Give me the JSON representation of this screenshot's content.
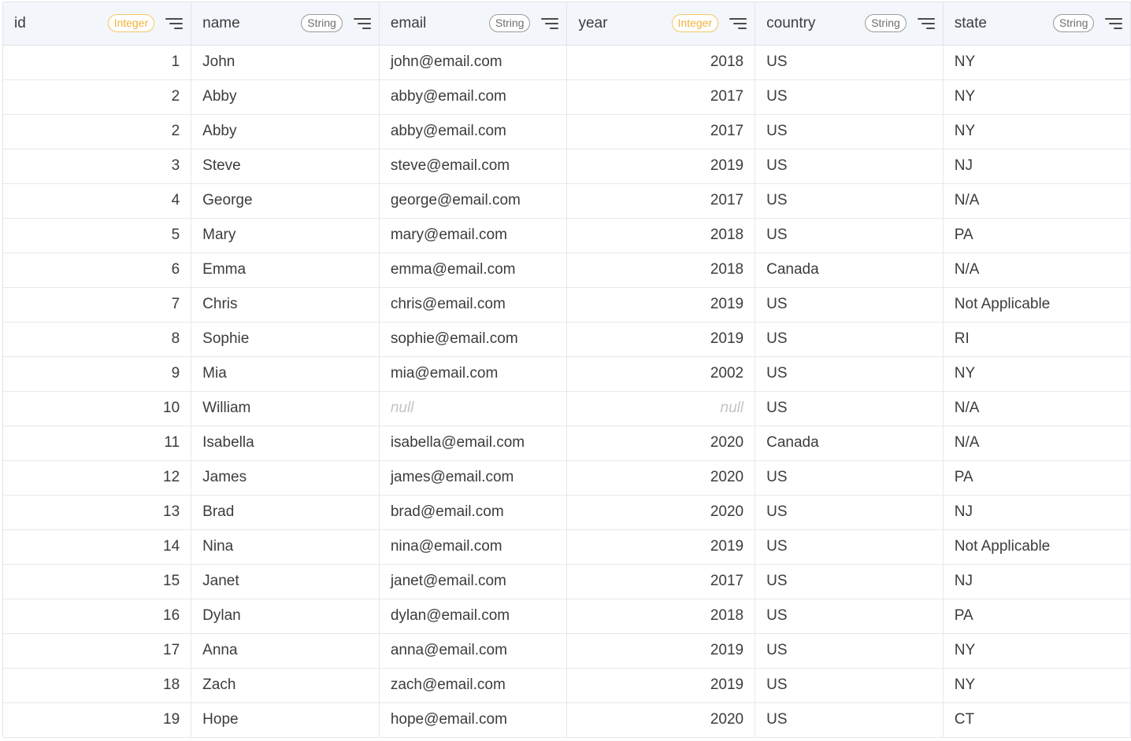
{
  "columns": [
    {
      "key": "id",
      "label": "id",
      "type": "Integer"
    },
    {
      "key": "name",
      "label": "name",
      "type": "String"
    },
    {
      "key": "email",
      "label": "email",
      "type": "String"
    },
    {
      "key": "year",
      "label": "year",
      "type": "Integer"
    },
    {
      "key": "country",
      "label": "country",
      "type": "String"
    },
    {
      "key": "state",
      "label": "state",
      "type": "String"
    }
  ],
  "null_text": "null",
  "rows": [
    {
      "id": "1",
      "name": "John",
      "email": "john@email.com",
      "year": "2018",
      "country": "US",
      "state": "NY"
    },
    {
      "id": "2",
      "name": "Abby",
      "email": "abby@email.com",
      "year": "2017",
      "country": "US",
      "state": "NY"
    },
    {
      "id": "2",
      "name": "Abby",
      "email": "abby@email.com",
      "year": "2017",
      "country": "US",
      "state": "NY"
    },
    {
      "id": "3",
      "name": "Steve",
      "email": "steve@email.com",
      "year": "2019",
      "country": "US",
      "state": "NJ"
    },
    {
      "id": "4",
      "name": "George",
      "email": "george@email.com",
      "year": "2017",
      "country": "US",
      "state": "N/A"
    },
    {
      "id": "5",
      "name": "Mary",
      "email": "mary@email.com",
      "year": "2018",
      "country": "US",
      "state": "PA"
    },
    {
      "id": "6",
      "name": "Emma",
      "email": "emma@email.com",
      "year": "2018",
      "country": "Canada",
      "state": "N/A"
    },
    {
      "id": "7",
      "name": "Chris",
      "email": "chris@email.com",
      "year": "2019",
      "country": "US",
      "state": "Not Applicable"
    },
    {
      "id": "8",
      "name": "Sophie",
      "email": "sophie@email.com",
      "year": "2019",
      "country": "US",
      "state": "RI"
    },
    {
      "id": "9",
      "name": "Mia",
      "email": "mia@email.com",
      "year": "2002",
      "country": "US",
      "state": "NY"
    },
    {
      "id": "10",
      "name": "William",
      "email": null,
      "year": null,
      "country": "US",
      "state": "N/A"
    },
    {
      "id": "11",
      "name": "Isabella",
      "email": "isabella@email.com",
      "year": "2020",
      "country": "Canada",
      "state": "N/A"
    },
    {
      "id": "12",
      "name": "James",
      "email": "james@email.com",
      "year": "2020",
      "country": "US",
      "state": "PA"
    },
    {
      "id": "13",
      "name": "Brad",
      "email": "brad@email.com",
      "year": "2020",
      "country": "US",
      "state": "NJ"
    },
    {
      "id": "14",
      "name": "Nina",
      "email": "nina@email.com",
      "year": "2019",
      "country": "US",
      "state": "Not Applicable"
    },
    {
      "id": "15",
      "name": "Janet",
      "email": "janet@email.com",
      "year": "2017",
      "country": "US",
      "state": "NJ"
    },
    {
      "id": "16",
      "name": "Dylan",
      "email": "dylan@email.com",
      "year": "2018",
      "country": "US",
      "state": "PA"
    },
    {
      "id": "17",
      "name": "Anna",
      "email": "anna@email.com",
      "year": "2019",
      "country": "US",
      "state": "NY"
    },
    {
      "id": "18",
      "name": "Zach",
      "email": "zach@email.com",
      "year": "2019",
      "country": "US",
      "state": "NY"
    },
    {
      "id": "19",
      "name": "Hope",
      "email": "hope@email.com",
      "year": "2020",
      "country": "US",
      "state": "CT"
    }
  ],
  "colors": {
    "header_bg": "#f3f6fb",
    "integer_badge": "#f0b23c",
    "string_badge": "#6f6f6f",
    "null_text": "#c4c4c4",
    "grid_line": "#e6e8ec"
  },
  "icons": {
    "sort": "sort-lines-icon"
  }
}
